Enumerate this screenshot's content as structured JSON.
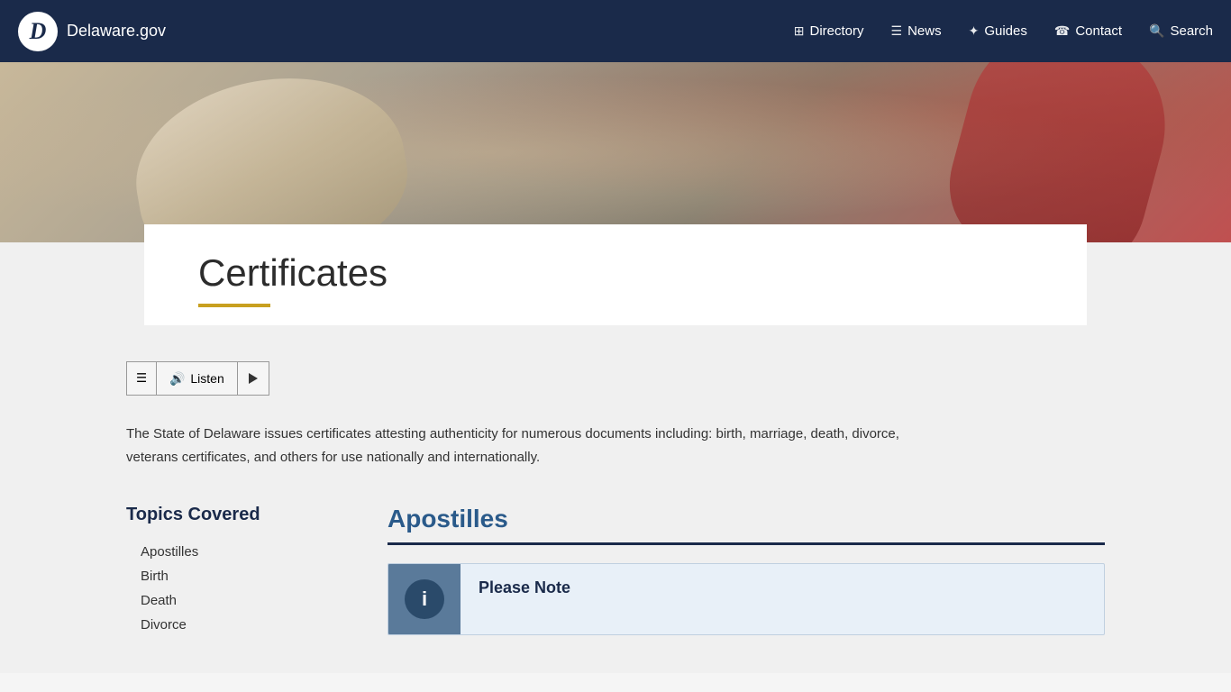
{
  "header": {
    "logo_text": "Delaware.gov",
    "logo_letter": "D",
    "nav": [
      {
        "id": "directory",
        "label": "Directory",
        "icon": "⊞"
      },
      {
        "id": "news",
        "label": "News",
        "icon": "≡"
      },
      {
        "id": "guides",
        "label": "Guides",
        "icon": "✦"
      },
      {
        "id": "contact",
        "label": "Contact",
        "icon": "☎"
      },
      {
        "id": "search",
        "label": "Search",
        "icon": "🔍"
      }
    ]
  },
  "page": {
    "title": "Certificates",
    "intro": "The State of Delaware issues certificates attesting authenticity for numerous documents including: birth, marriage, death, divorce, veterans certificates, and others for use nationally and internationally."
  },
  "listen_bar": {
    "listen_label": "Listen",
    "menu_icon": "≡",
    "speaker_icon": "🔊"
  },
  "sidebar": {
    "title": "Topics Covered",
    "items": [
      {
        "id": "apostilles",
        "label": "Apostilles"
      },
      {
        "id": "birth",
        "label": "Birth"
      },
      {
        "id": "death",
        "label": "Death"
      },
      {
        "id": "divorce",
        "label": "Divorce"
      }
    ]
  },
  "main_section": {
    "heading": "Apostilles",
    "note": {
      "icon_text": "i",
      "title": "Please Note"
    }
  }
}
